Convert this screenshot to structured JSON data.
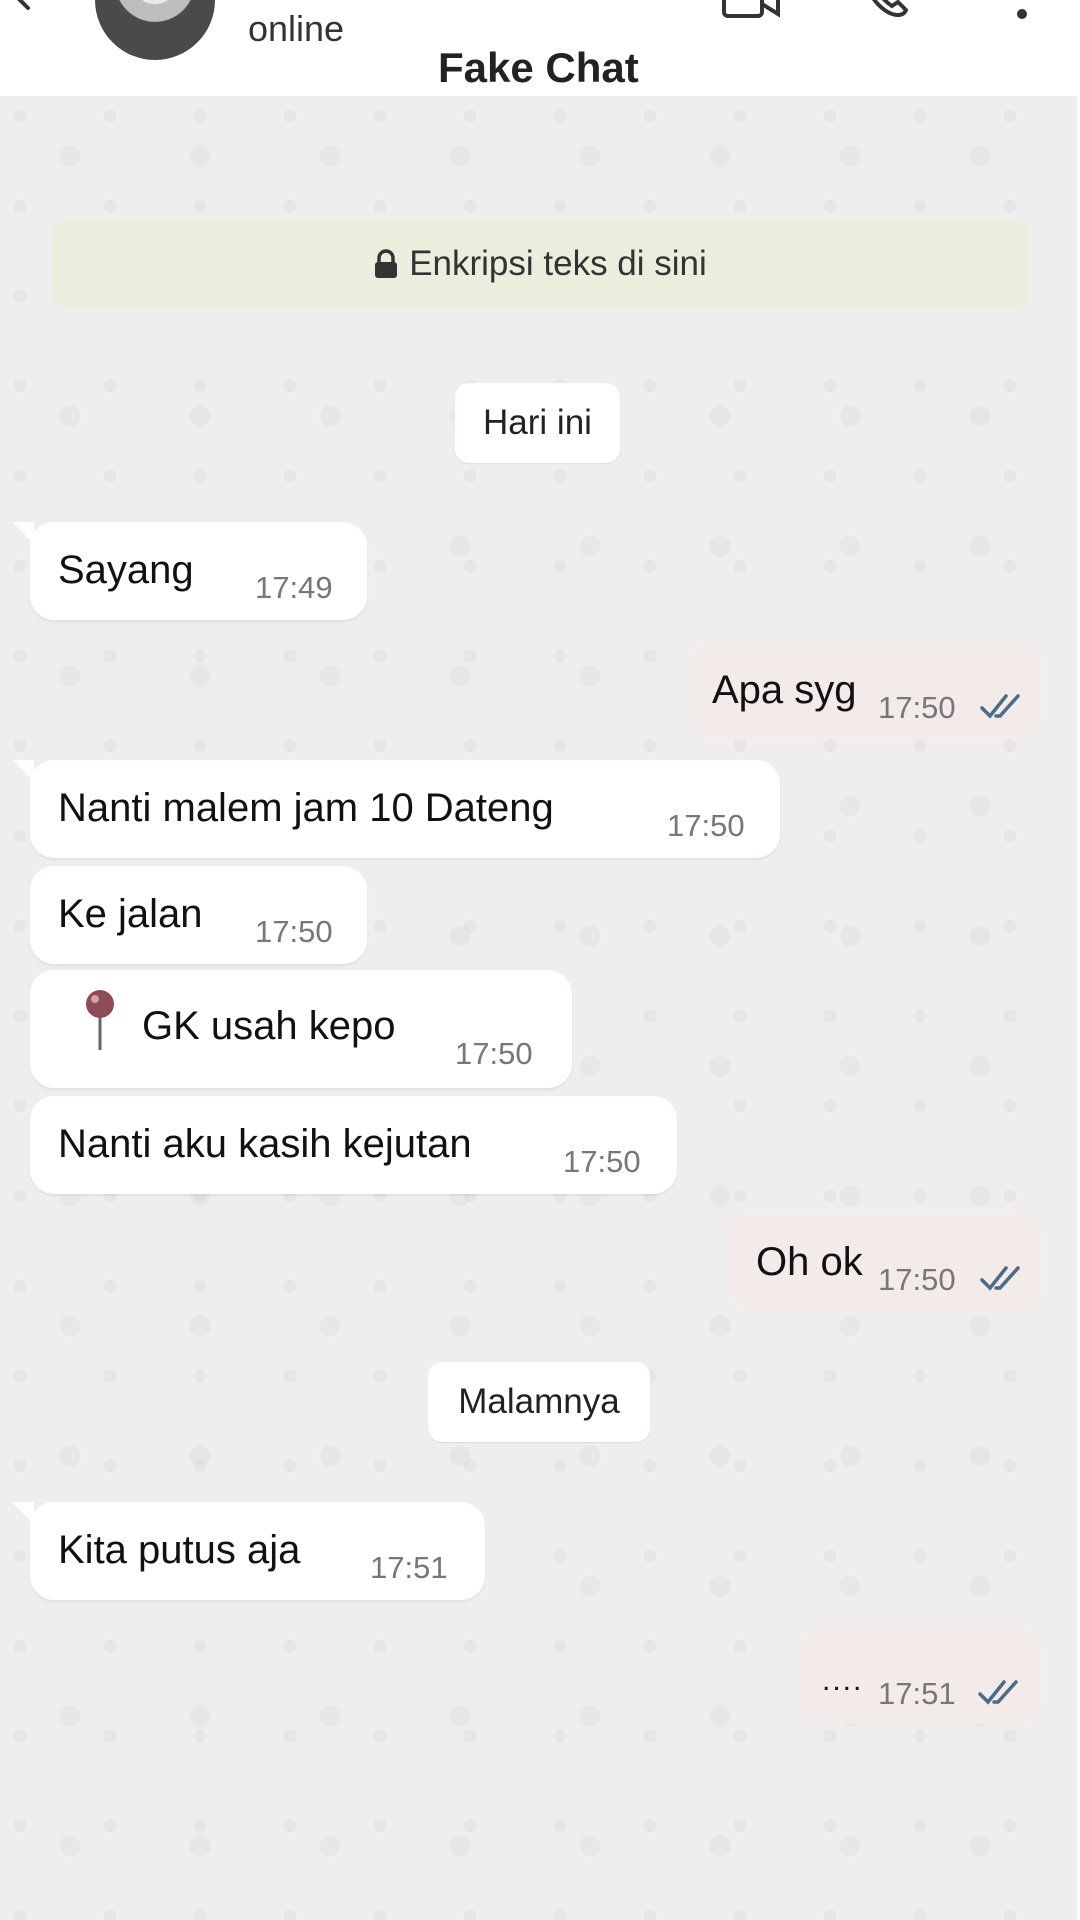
{
  "header": {
    "status": "online",
    "app_name": "Fake Chat",
    "icons": [
      "back-arrow-icon",
      "video-call-icon",
      "phone-call-icon",
      "more-vert-icon"
    ]
  },
  "encryption_notice": {
    "icon": "lock-icon",
    "text": "Enkripsi teks di sini"
  },
  "date_pills": {
    "today": "Hari ini",
    "night": "Malamnya"
  },
  "messages": [
    {
      "direction": "incoming",
      "text": "Sayang",
      "time": "17:49"
    },
    {
      "direction": "outgoing",
      "text": "Apa syg",
      "time": "17:50",
      "status": "read"
    },
    {
      "direction": "incoming",
      "text": "Nanti malem jam 10 Dateng",
      "time": "17:50"
    },
    {
      "direction": "incoming",
      "text": "Ke jalan",
      "time": "17:50"
    },
    {
      "direction": "incoming",
      "text": "GK usah kepo",
      "time": "17:50",
      "icon": "pushpin-icon"
    },
    {
      "direction": "incoming",
      "text": "Nanti aku kasih kejutan",
      "time": "17:50"
    },
    {
      "direction": "outgoing",
      "text": "Oh ok",
      "time": "17:50",
      "status": "read"
    },
    {
      "direction": "incoming",
      "text": "Kita putus aja",
      "time": "17:51"
    },
    {
      "direction": "outgoing",
      "text": "....",
      "time": "17:51",
      "status": "read"
    }
  ],
  "colors": {
    "chat_background": "#efeded",
    "incoming_bubble": "#ffffff",
    "outgoing_bubble": "#f3eaea",
    "encryption_banner": "#eceedd",
    "read_ticks": "#4a6c86"
  }
}
